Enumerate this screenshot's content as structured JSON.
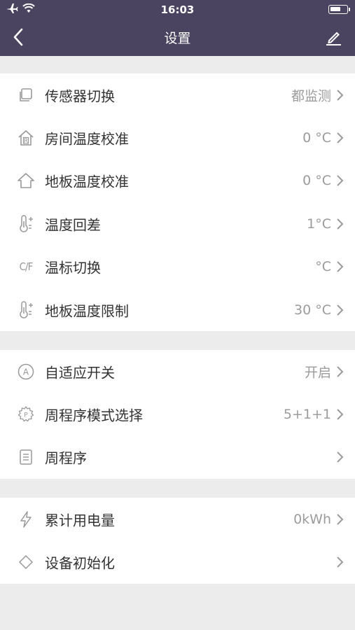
{
  "status_bar": {
    "time": "16:03"
  },
  "header": {
    "title": "设置"
  },
  "groups": [
    {
      "items": [
        {
          "icon": "copy-icon",
          "label": "传感器切换",
          "value": "都监测"
        },
        {
          "icon": "home-r-icon",
          "label": "房间温度校准",
          "value": "0 °C"
        },
        {
          "icon": "home-icon",
          "label": "地板温度校准",
          "value": "0 °C"
        },
        {
          "icon": "thermometer-plus-icon",
          "label": "温度回差",
          "value": "1°C"
        },
        {
          "icon": "cf-icon",
          "icon_text": "C/F",
          "label": "温标切换",
          "value": "°C"
        },
        {
          "icon": "thermometer-plus-icon",
          "label": "地板温度限制",
          "value": "30 °C"
        }
      ]
    },
    {
      "items": [
        {
          "icon": "circle-a-icon",
          "label": "自适应开关",
          "value": "开启"
        },
        {
          "icon": "gear-p-icon",
          "label": "周程序模式选择",
          "value": "5+1+1"
        },
        {
          "icon": "list-icon",
          "label": "周程序",
          "value": ""
        }
      ]
    },
    {
      "items": [
        {
          "icon": "lightning-icon",
          "label": "累计用电量",
          "value": "0kWh"
        },
        {
          "icon": "diamond-icon",
          "label": "设备初始化",
          "value": ""
        }
      ]
    }
  ]
}
